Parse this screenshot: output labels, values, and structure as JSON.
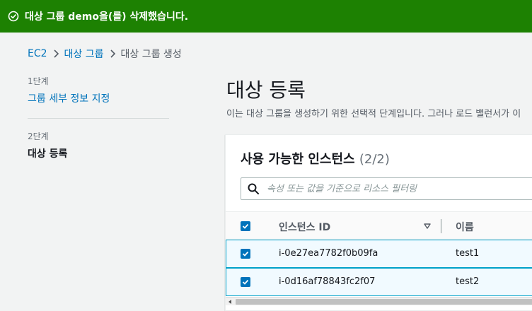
{
  "flash": {
    "message": "대상 그룹 demo을(를) 삭제했습니다.",
    "color": "#1d8102"
  },
  "breadcrumb": {
    "items": [
      "EC2",
      "대상 그룹"
    ],
    "current": "대상 그룹 생성"
  },
  "wizard": {
    "steps": [
      {
        "number": "1단계",
        "label": "그룹 세부 정보 지정",
        "state": "link"
      },
      {
        "number": "2단계",
        "label": "대상 등록",
        "state": "active"
      }
    ]
  },
  "main": {
    "title": "대상 등록",
    "description": "이는 대상 그룹을 생성하기 위한 선택적 단계입니다. 그러나 로드 밸런서가 이"
  },
  "panel": {
    "title": "사용 가능한 인스턴스",
    "count": "(2/2)",
    "search_placeholder": "속성 또는 값을 기준으로 리소스 필터링",
    "columns": [
      "인스턴스 ID",
      "이름"
    ],
    "rows": [
      {
        "instance_id": "i-0e27ea7782f0b09fa",
        "name": "test1",
        "checked": true
      },
      {
        "instance_id": "i-0d16af78843fc2f07",
        "name": "test2",
        "checked": true
      }
    ],
    "header_checked": true
  },
  "icons": {
    "flash": "check-circle-icon",
    "breadcrumb_sep": "chevron-right-icon",
    "search": "search-icon",
    "sort": "caret-down-icon",
    "checkbox": "checkmark-icon"
  },
  "colors": {
    "link": "#0073bb",
    "checkbox": "#0073bb",
    "selected_row_bg": "#f1faff",
    "selected_row_border": "#00a1c9"
  }
}
